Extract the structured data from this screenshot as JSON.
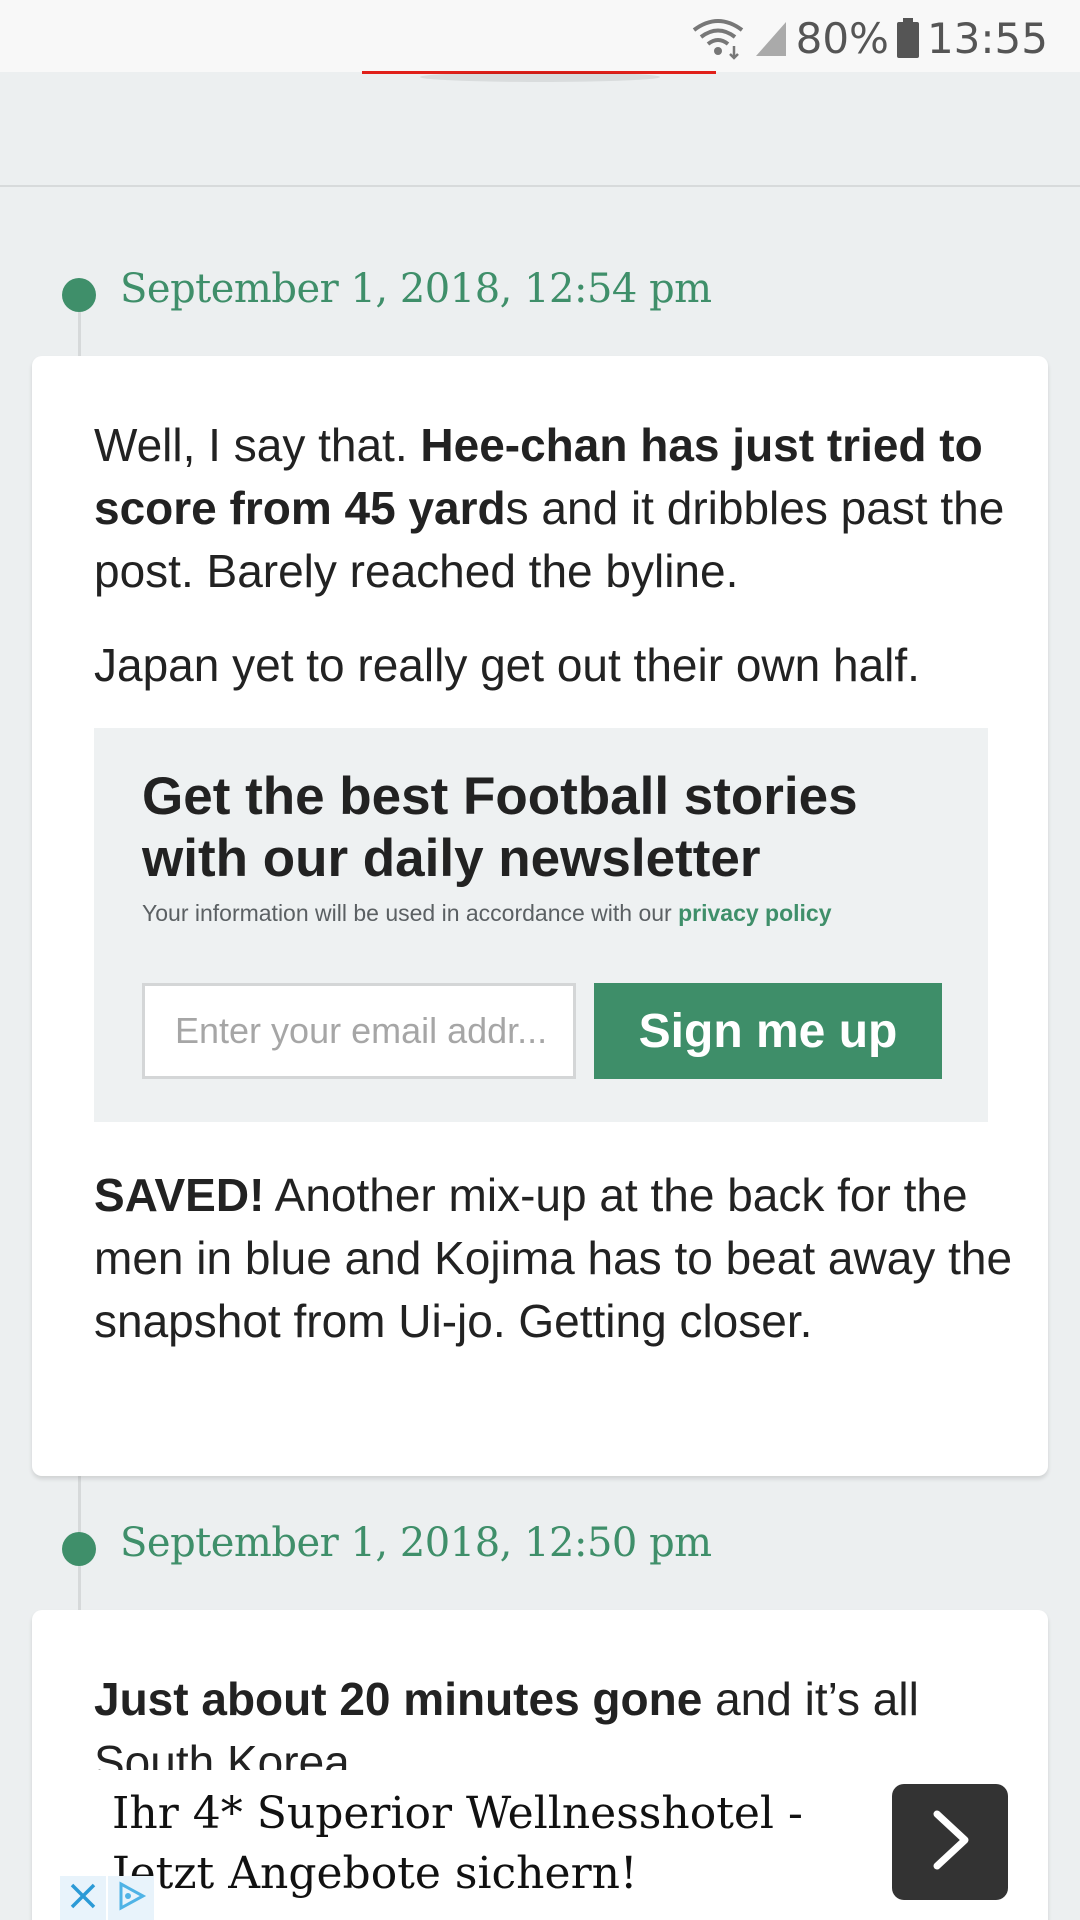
{
  "status_bar": {
    "battery": "80%",
    "time": "13:55",
    "icons": [
      "wifi-icon",
      "signal-icon",
      "battery-icon"
    ]
  },
  "entries": [
    {
      "time": "September 1, 2018, 12:54 pm",
      "paragraph1": {
        "text1": "Well, I say that. ",
        "bold": "Hee-chan has just tried to score from 45 yard",
        "text2": "s and it dribbles past the post. Barely reached the byline."
      },
      "paragraph2": "Japan yet to really get out their own half.",
      "paragraph3": {
        "bold": "SAVED!",
        "text": " Another mix-up at the back for the men in blue and Kojima has to beat away the snapshot from Ui-jo. Getting closer."
      }
    },
    {
      "time": "September 1, 2018, 12:50 pm",
      "paragraph1": {
        "bold": "Just about 20 minutes gone",
        "text": " and it’s all South Korea."
      }
    }
  ],
  "newsletter": {
    "title": "Get the best Football stories with our daily newsletter",
    "privacy_text": "Your information will be used in accordance with our ",
    "privacy_link": "privacy policy",
    "email_placeholder": "Enter your email addr...",
    "button_label": "Sign me up"
  },
  "ad": {
    "text": "Ihr 4* Superior Wellnesshotel - Jetzt Angebote sichern!",
    "icons": [
      "chevron-right-icon",
      "close-icon",
      "adchoices-icon"
    ]
  },
  "colors": {
    "accent_green": "#3f8f6a",
    "tab_red": "#e0201a",
    "page_background": "#eceff0"
  }
}
